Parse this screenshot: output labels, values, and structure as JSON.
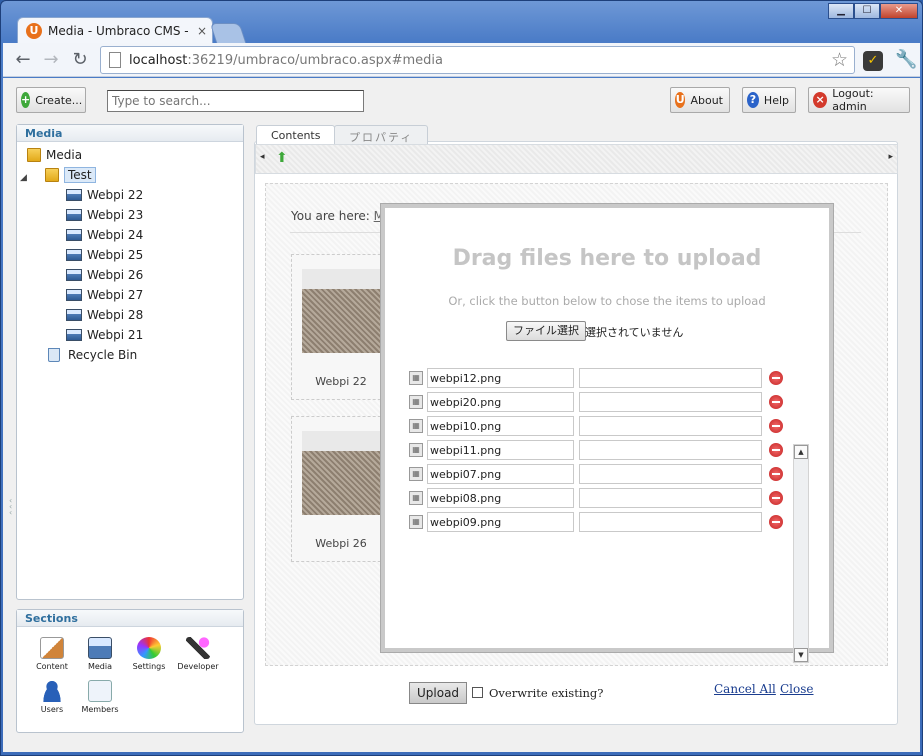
{
  "browser": {
    "tab_title": "Media - Umbraco CMS - lo",
    "tab_close": "×",
    "url_host": "localhost",
    "url_rest": ":36219/umbraco/umbraco.aspx#media",
    "window_buttons": {
      "minimize": "▁",
      "maximize": "☐",
      "close": "✕"
    }
  },
  "topbar": {
    "create_label": "Create...",
    "search_placeholder": "Type to search...",
    "about_label": "About",
    "help_label": "Help",
    "logout_label": "Logout: admin"
  },
  "tree": {
    "header": "Media",
    "root": "Media",
    "folder": "Test",
    "items": [
      "Webpi 22",
      "Webpi 23",
      "Webpi 24",
      "Webpi 25",
      "Webpi 26",
      "Webpi 27",
      "Webpi 28",
      "Webpi 21"
    ],
    "recycle_bin": "Recycle Bin"
  },
  "sections": {
    "header": "Sections",
    "items": [
      "Content",
      "Media",
      "Settings",
      "Developer",
      "Users",
      "Members"
    ]
  },
  "content": {
    "tabs": [
      "Contents",
      "プロパティ"
    ],
    "you_are_here": "You are here:",
    "crumb": "M",
    "thumbnails": [
      "Webpi 22",
      "Webpi 26"
    ]
  },
  "upload_dialog": {
    "title": "Drag files here to upload",
    "subtitle": "Or, click the button below to chose the items to upload",
    "choose_button": "ファイル選択",
    "no_file_text": "選択されていません",
    "files": [
      "webpi12.png",
      "webpi20.png",
      "webpi10.png",
      "webpi11.png",
      "webpi07.png",
      "webpi08.png",
      "webpi09.png"
    ],
    "upload_button": "Upload",
    "overwrite_label": "Overwrite existing?",
    "cancel_all": "Cancel All",
    "close": "Close"
  },
  "colors": {
    "accent": "#2f6f9e",
    "window_frame": "#4b7cc7",
    "link": "#1a3d8f"
  }
}
